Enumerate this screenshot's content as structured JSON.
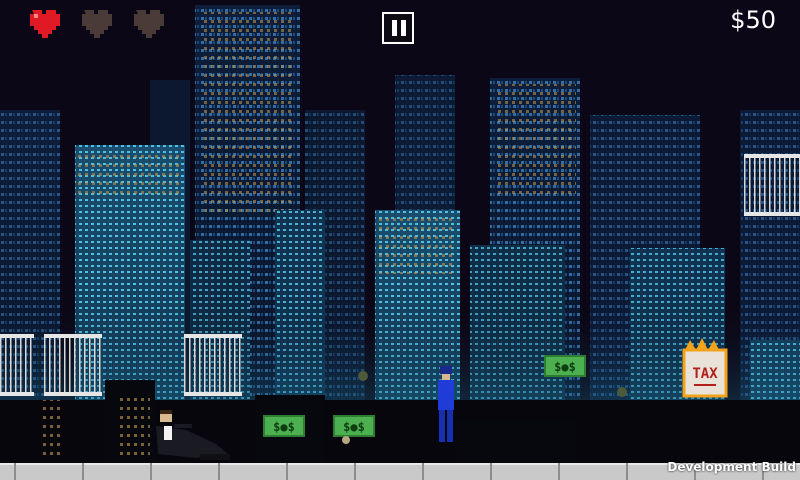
{
  "hud": {
    "money": "$50",
    "lives_total": 3,
    "lives_remaining": 1,
    "pause_icon": "pause-icon",
    "heart_full_color": "#e01a24",
    "heart_empty_color": "#4a3b38"
  },
  "pickups": {
    "cash_label": "$●$",
    "tax_label": "TAX"
  },
  "footer": {
    "dev_build": "Development Build"
  },
  "colors": {
    "sky": "#0b0716",
    "building_window": "#3aa7c9",
    "building_window_warm": "#d4a65a",
    "ground": "#c9c9c9",
    "cash": "#4caf50"
  }
}
